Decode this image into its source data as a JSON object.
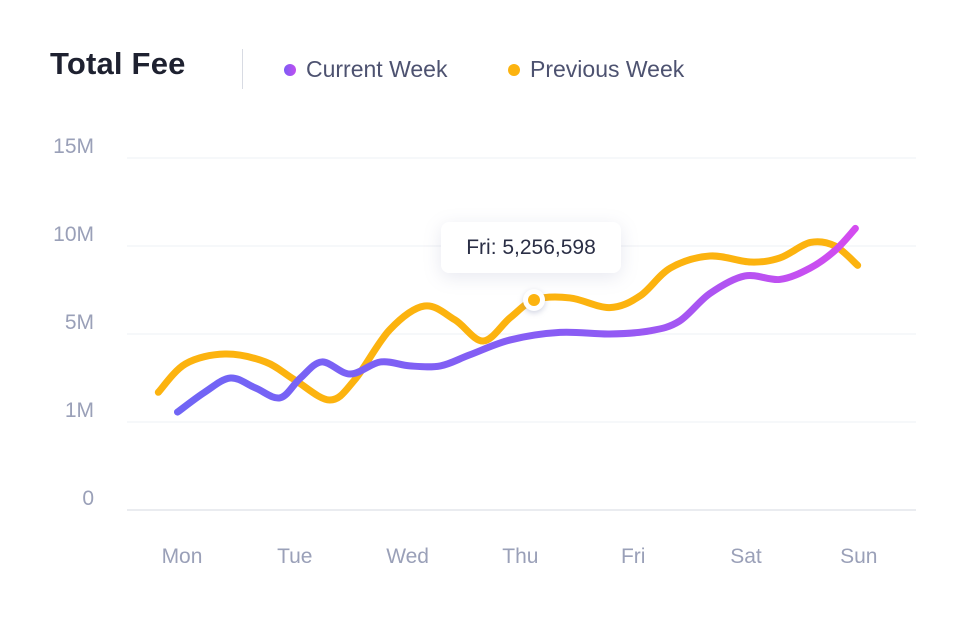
{
  "header": {
    "title": "Total Fee"
  },
  "legend": {
    "current_label": "Current Week",
    "previous_label": "Previous Week"
  },
  "tooltip": {
    "label": "Fri: 5,256,598",
    "series": "Previous Week"
  },
  "colors": {
    "current_start": "#7065f5",
    "current_end": "#d44cf0",
    "previous": "#fcb30f",
    "grid": "#eef0f4",
    "axis_text": "#9aa0b8"
  },
  "chart_data": {
    "type": "line",
    "title": "Total Fee",
    "xlabel": "",
    "ylabel": "",
    "categories": [
      "Mon",
      "Tue",
      "Wed",
      "Thu",
      "Fri",
      "Sat",
      "Sun"
    ],
    "y_ticks": [
      {
        "label": "0",
        "value": 0
      },
      {
        "label": "1M",
        "value": 1000000
      },
      {
        "label": "5M",
        "value": 5000000
      },
      {
        "label": "10M",
        "value": 10000000
      },
      {
        "label": "15M",
        "value": 15000000
      }
    ],
    "ylim": [
      0,
      15000000
    ],
    "grid": true,
    "legend_position": "top",
    "curve": "smooth",
    "series": [
      {
        "name": "Current Week",
        "points": [
          [
            -0.04,
            1.45
          ],
          [
            0.2,
            2.35
          ],
          [
            0.43,
            3.0
          ],
          [
            0.65,
            2.55
          ],
          [
            0.87,
            2.1
          ],
          [
            1.05,
            3.0
          ],
          [
            1.24,
            3.73
          ],
          [
            1.49,
            3.18
          ],
          [
            1.76,
            3.73
          ],
          [
            2.02,
            3.55
          ],
          [
            2.29,
            3.55
          ],
          [
            2.55,
            4.05
          ],
          [
            2.91,
            4.73
          ],
          [
            3.35,
            5.09
          ],
          [
            3.79,
            5.0
          ],
          [
            4.15,
            5.18
          ],
          [
            4.41,
            5.73
          ],
          [
            4.68,
            7.3
          ],
          [
            4.99,
            8.3
          ],
          [
            5.3,
            8.1
          ],
          [
            5.57,
            8.75
          ],
          [
            5.79,
            9.75
          ],
          [
            5.97,
            11.0
          ]
        ]
      },
      {
        "name": "Previous Week",
        "points": [
          [
            -0.21,
            2.35
          ],
          [
            0.03,
            3.64
          ],
          [
            0.38,
            4.09
          ],
          [
            0.74,
            3.73
          ],
          [
            1.0,
            2.91
          ],
          [
            1.31,
            2.0
          ],
          [
            1.53,
            2.91
          ],
          [
            1.84,
            5.23
          ],
          [
            2.15,
            6.59
          ],
          [
            2.42,
            5.8
          ],
          [
            2.67,
            4.68
          ],
          [
            2.91,
            5.93
          ],
          [
            3.13,
            6.95
          ],
          [
            3.44,
            7.05
          ],
          [
            3.79,
            6.5
          ],
          [
            4.06,
            7.16
          ],
          [
            4.33,
            8.75
          ],
          [
            4.68,
            9.43
          ],
          [
            5.04,
            9.09
          ],
          [
            5.3,
            9.32
          ],
          [
            5.57,
            10.2
          ],
          [
            5.79,
            10.0
          ],
          [
            5.99,
            8.9
          ]
        ],
        "highlight": {
          "category": "Fri",
          "value": 5256598
        }
      }
    ]
  }
}
